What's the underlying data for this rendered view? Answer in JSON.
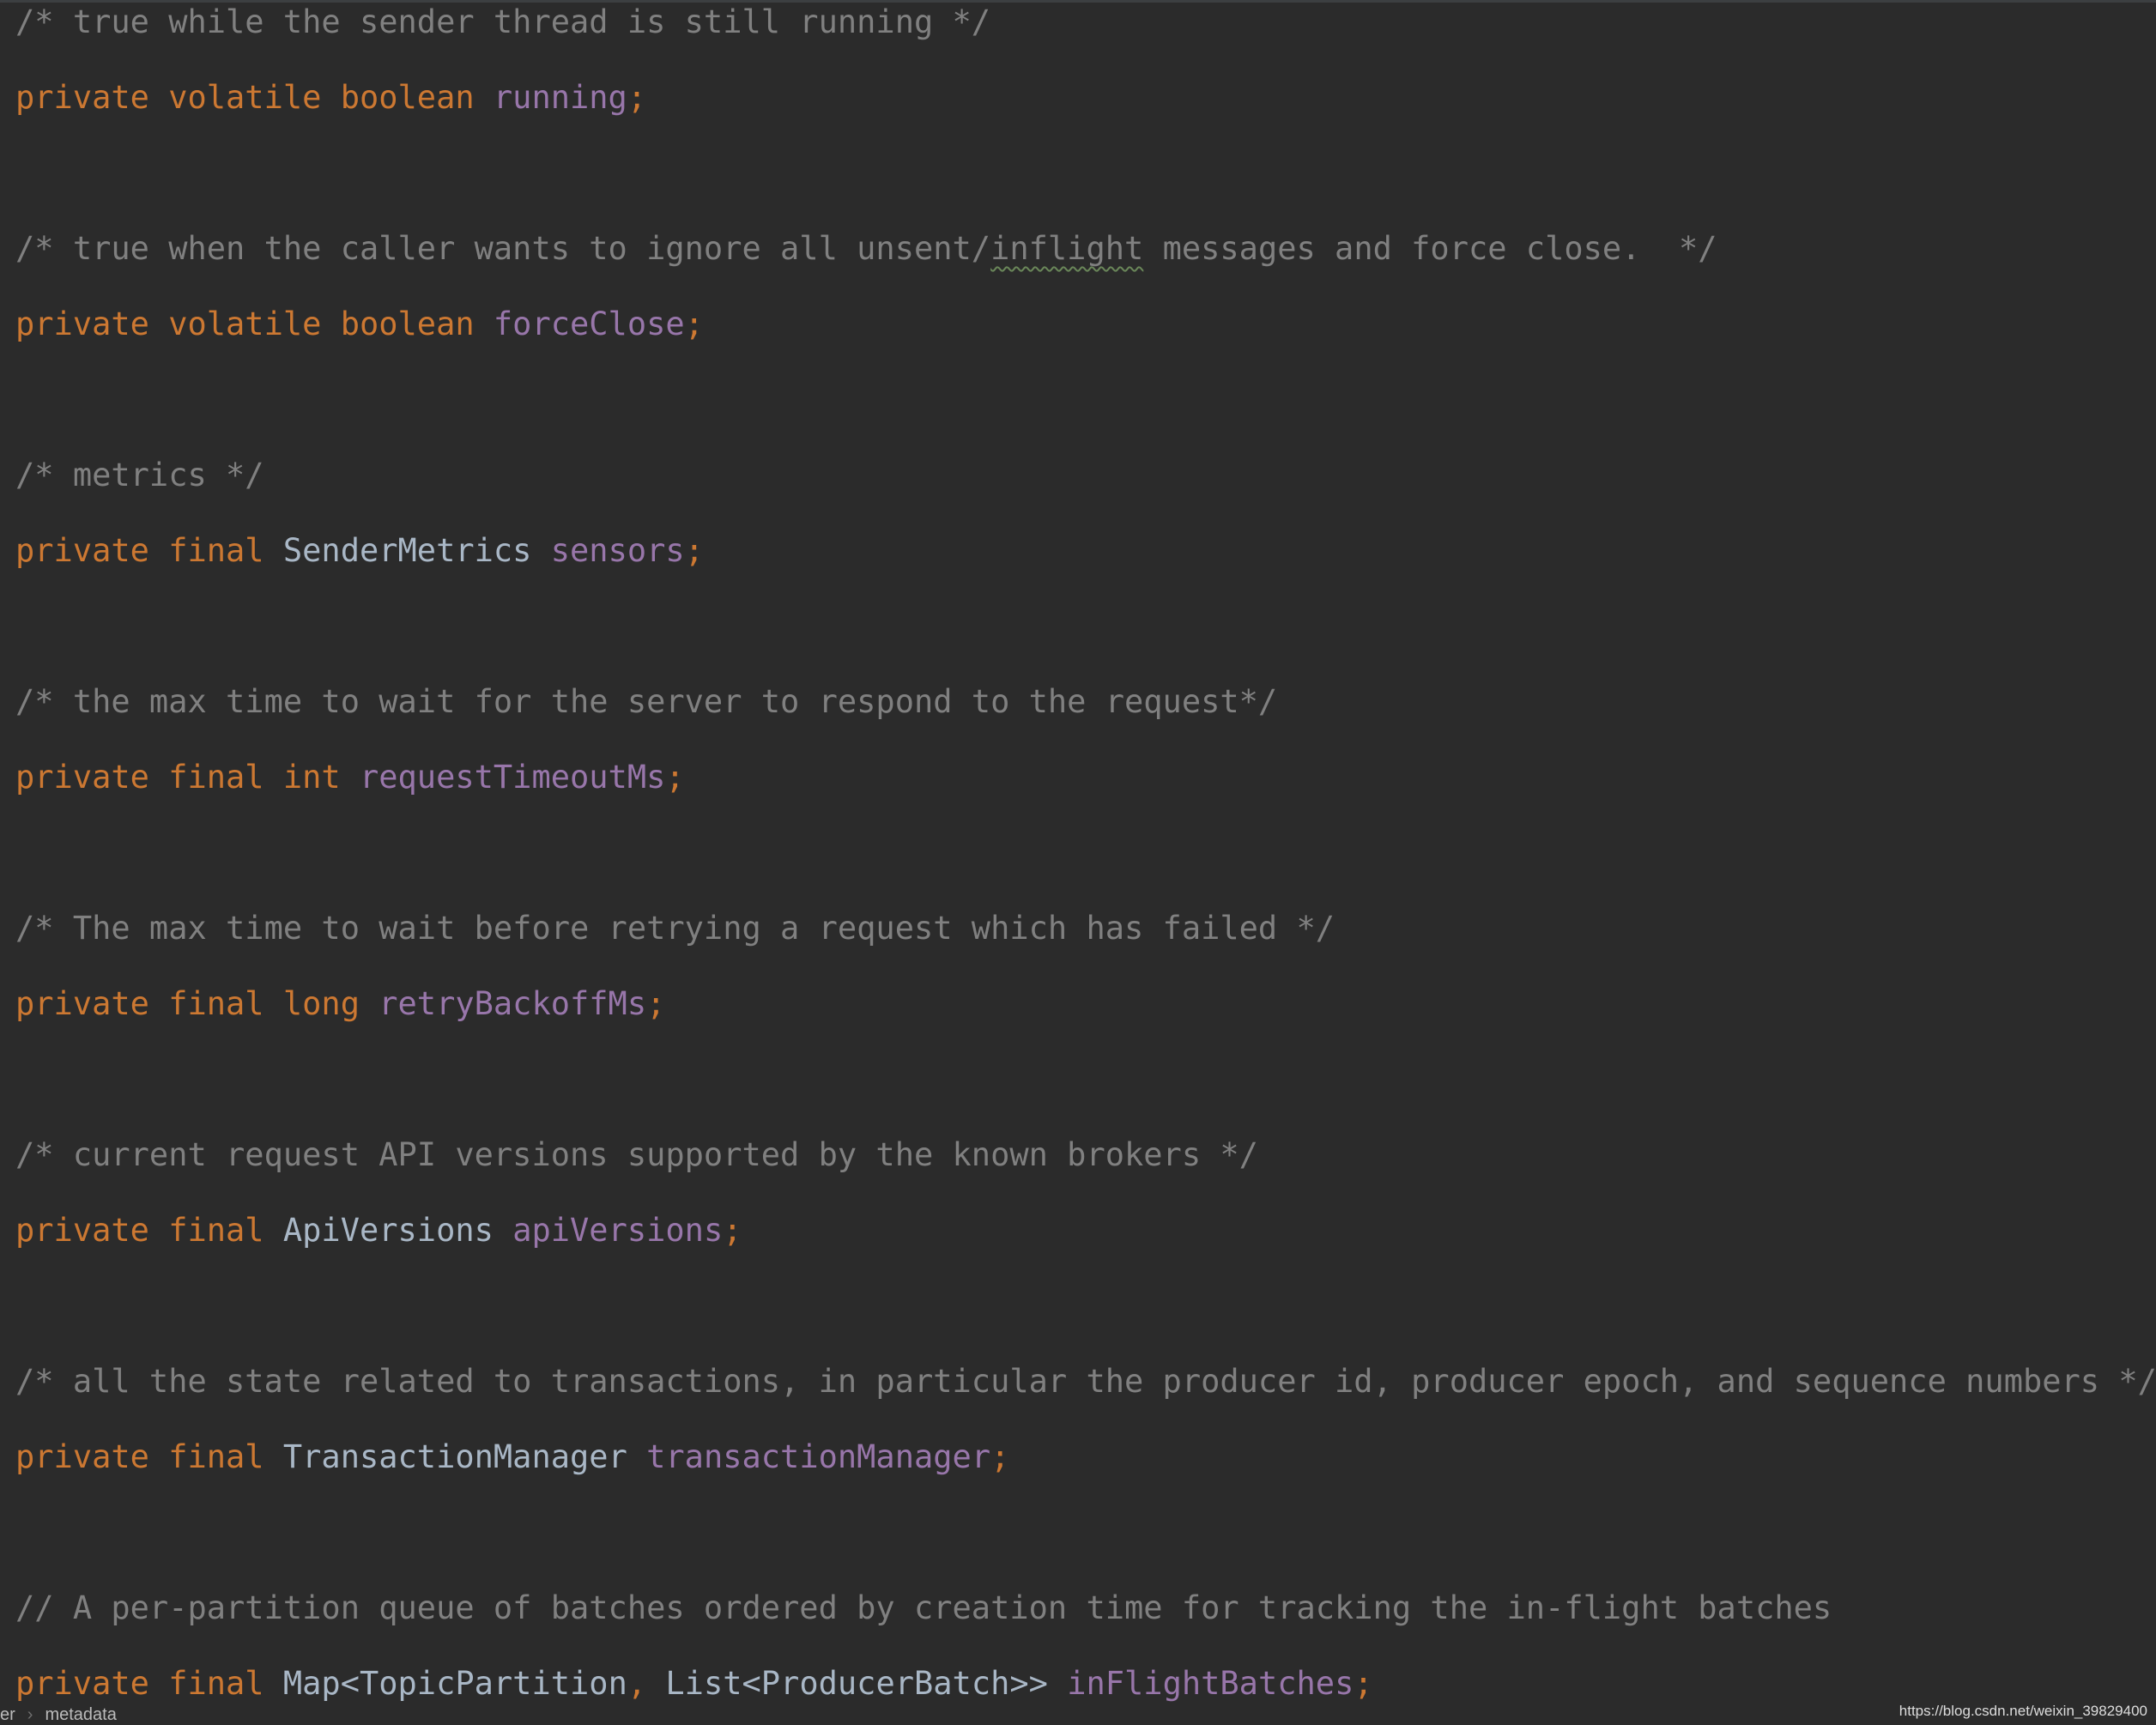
{
  "editor": {
    "lines": {
      "c1": "/* true while the sender thread is still running */",
      "d1": {
        "kw": "private volatile boolean ",
        "field": "running",
        "punct": ";"
      },
      "c2": {
        "before": "/* true when the caller wants to ignore all unsent/",
        "typo": "inflight",
        "after": " messages and force close.  */"
      },
      "d2": {
        "kw": "private volatile boolean ",
        "field": "forceClose",
        "punct": ";"
      },
      "c3": "/* metrics */",
      "d3": {
        "kw": "private final ",
        "type": "SenderMetrics ",
        "field": "sensors",
        "punct": ";"
      },
      "c4": "/* the max time to wait for the server to respond to the request*/",
      "d4": {
        "kw": "private final int ",
        "field": "requestTimeoutMs",
        "punct": ";"
      },
      "c5": "/* The max time to wait before retrying a request which has failed */",
      "d5": {
        "kw": "private final long ",
        "field": "retryBackoffMs",
        "punct": ";"
      },
      "c6": "/* current request API versions supported by the known brokers */",
      "d6": {
        "kw": "private final ",
        "type": "ApiVersions ",
        "field": "apiVersions",
        "punct": ";"
      },
      "c7": "/* all the state related to transactions, in particular the producer id, producer epoch, and sequence numbers */",
      "d7": {
        "kw": "private final ",
        "type": "TransactionManager ",
        "field": "transactionManager",
        "punct": ";"
      },
      "c8": "// A per-partition queue of batches ordered by creation time for tracking the in-flight batches",
      "d8": {
        "kw": "private final ",
        "type1": "Map<TopicPartition",
        "comma": ", ",
        "type2": "List<ProducerBatch>> ",
        "field": "inFlightBatches",
        "punct": ";"
      }
    }
  },
  "breadcrumb": {
    "partial": "er",
    "separator": "›",
    "current": "metadata"
  },
  "watermark": "https://blog.csdn.net/weixin_39829400",
  "colors": {
    "background": "#2b2b2b",
    "comment": "#808080",
    "keyword": "#cc7832",
    "type": "#a9b7c6",
    "field": "#9876aa",
    "typo_underline": "#6a8759"
  }
}
